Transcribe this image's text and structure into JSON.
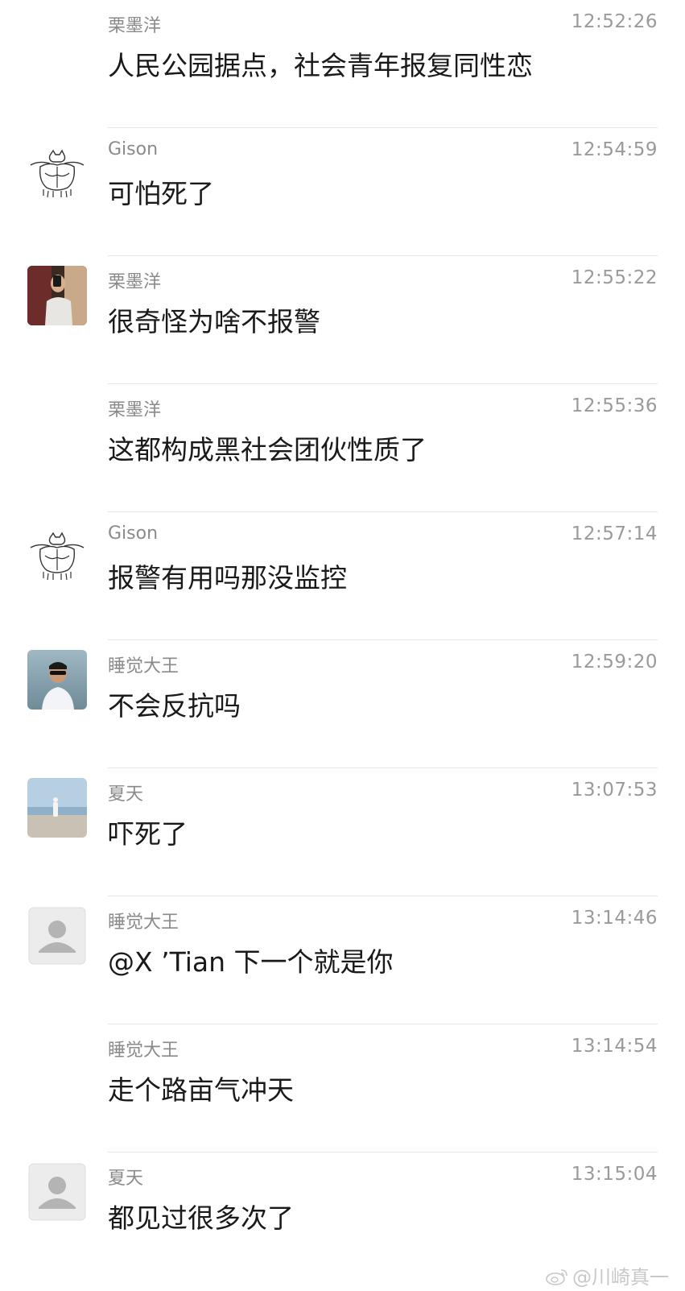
{
  "messages": [
    {
      "sender": "栗墨洋",
      "time": "12:52:26",
      "text": "人民公园据点，社会青年报复同性恋",
      "avatar": "none"
    },
    {
      "sender": "Gison",
      "time": "12:54:59",
      "text": "可怕死了",
      "avatar": "sketch-cat-muscle-icon"
    },
    {
      "sender": "栗墨洋",
      "time": "12:55:22",
      "text": "很奇怪为啥不报警",
      "avatar": "mirror-selfie-photo"
    },
    {
      "sender": "栗墨洋",
      "time": "12:55:36",
      "text": "这都构成黑社会团伙性质了",
      "avatar": "none"
    },
    {
      "sender": "Gison",
      "time": "12:57:14",
      "text": "报警有用吗那没监控",
      "avatar": "sketch-cat-muscle-icon"
    },
    {
      "sender": "睡觉大王",
      "time": "12:59:20",
      "text": "不会反抗吗",
      "avatar": "man-sunglasses-photo"
    },
    {
      "sender": "夏天",
      "time": "13:07:53",
      "text": "吓死了",
      "avatar": "beach-person-photo"
    },
    {
      "sender": "睡觉大王",
      "time": "13:14:46",
      "text": "@X ’Tian 下一个就是你",
      "avatar": "default-user-icon"
    },
    {
      "sender": "睡觉大王",
      "time": "13:14:54",
      "text": "走个路亩气冲天",
      "avatar": "none"
    },
    {
      "sender": "夏天",
      "time": "13:15:04",
      "text": "都见过很多次了",
      "avatar": "default-user-icon"
    }
  ],
  "watermark": {
    "text": "@川崎真一",
    "icon": "weibo-logo-icon"
  },
  "colors": {
    "background": "#ffffff",
    "sender": "#8a8a8a",
    "time": "#9a9a9a",
    "message": "#1a1a1a",
    "divider": "#e6e6e6"
  }
}
